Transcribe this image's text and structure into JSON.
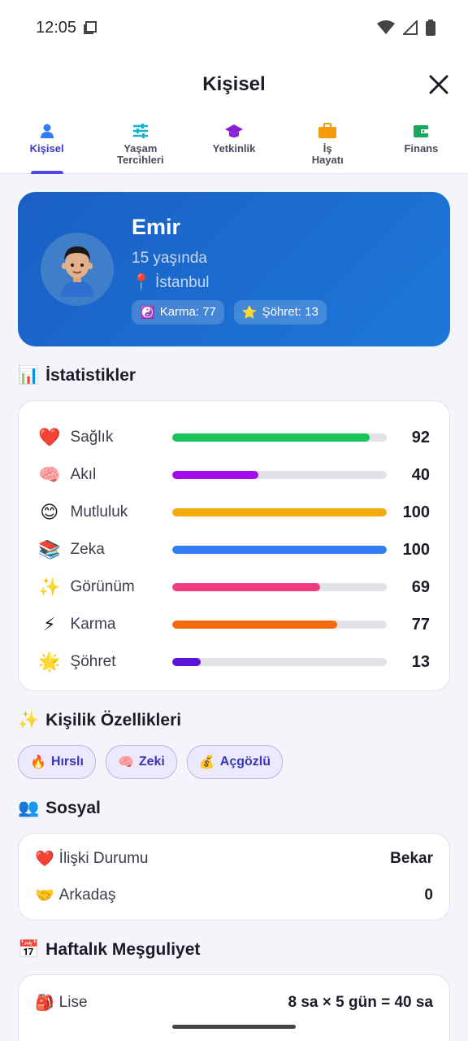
{
  "status_bar": {
    "time": "12:05"
  },
  "header": {
    "title": "Kişisel"
  },
  "tabs": [
    {
      "label": "Kişisel",
      "icon": "person-icon",
      "active": true
    },
    {
      "label": "Yaşam\nTercihleri",
      "icon": "sliders-icon"
    },
    {
      "label": "Yetkinlik",
      "icon": "graduation-cap-icon"
    },
    {
      "label": "İş\nHayatı",
      "icon": "briefcase-icon"
    },
    {
      "label": "Finans",
      "icon": "wallet-icon"
    }
  ],
  "profile": {
    "name": "Emir",
    "age": "15 yaşında",
    "location_icon": "📍",
    "location": "İstanbul",
    "karma_chip": {
      "icon": "☯️",
      "text": "Karma: 77"
    },
    "fame_chip": {
      "icon": "⭐",
      "text": "Şöhret: 13"
    }
  },
  "stats": {
    "title_icon": "📊",
    "title": "İstatistikler",
    "items": [
      {
        "emoji": "❤️",
        "label": "Sağlık",
        "value": 92,
        "color": "#18c45a"
      },
      {
        "emoji": "🧠",
        "label": "Akıl",
        "value": 40,
        "color": "#a20cef"
      },
      {
        "emoji": "😊",
        "label": "Mutluluk",
        "value": 100,
        "color": "#f7ac0b"
      },
      {
        "emoji": "📚",
        "label": "Zeka",
        "value": 100,
        "color": "#2f7cf3"
      },
      {
        "emoji": "✨",
        "label": "Görünüm",
        "value": 69,
        "color": "#f23c82"
      },
      {
        "emoji": "⚡",
        "label": "Karma",
        "value": 77,
        "color": "#f56b0b"
      },
      {
        "emoji": "🌟",
        "label": "Şöhret",
        "value": 13,
        "color": "#5b12d9"
      }
    ]
  },
  "traits": {
    "title_icon": "✨",
    "title": "Kişilik Özellikleri",
    "items": [
      {
        "emoji": "🔥",
        "label": "Hırslı"
      },
      {
        "emoji": "🧠",
        "label": "Zeki"
      },
      {
        "emoji": "💰",
        "label": "Açgözlü"
      }
    ]
  },
  "social": {
    "title_icon": "👥",
    "title": "Sosyal",
    "rows": [
      {
        "emoji": "❤️",
        "label": "İlişki Durumu",
        "value": "Bekar"
      },
      {
        "emoji": "🤝",
        "label": "Arkadaş",
        "value": "0"
      }
    ]
  },
  "weekly": {
    "title_icon": "📅",
    "title": "Haftalık Meşguliyet",
    "rows": [
      {
        "emoji": "🎒",
        "label": "Lise",
        "value": "8 sa × 5 gün = 40 sa"
      }
    ]
  }
}
